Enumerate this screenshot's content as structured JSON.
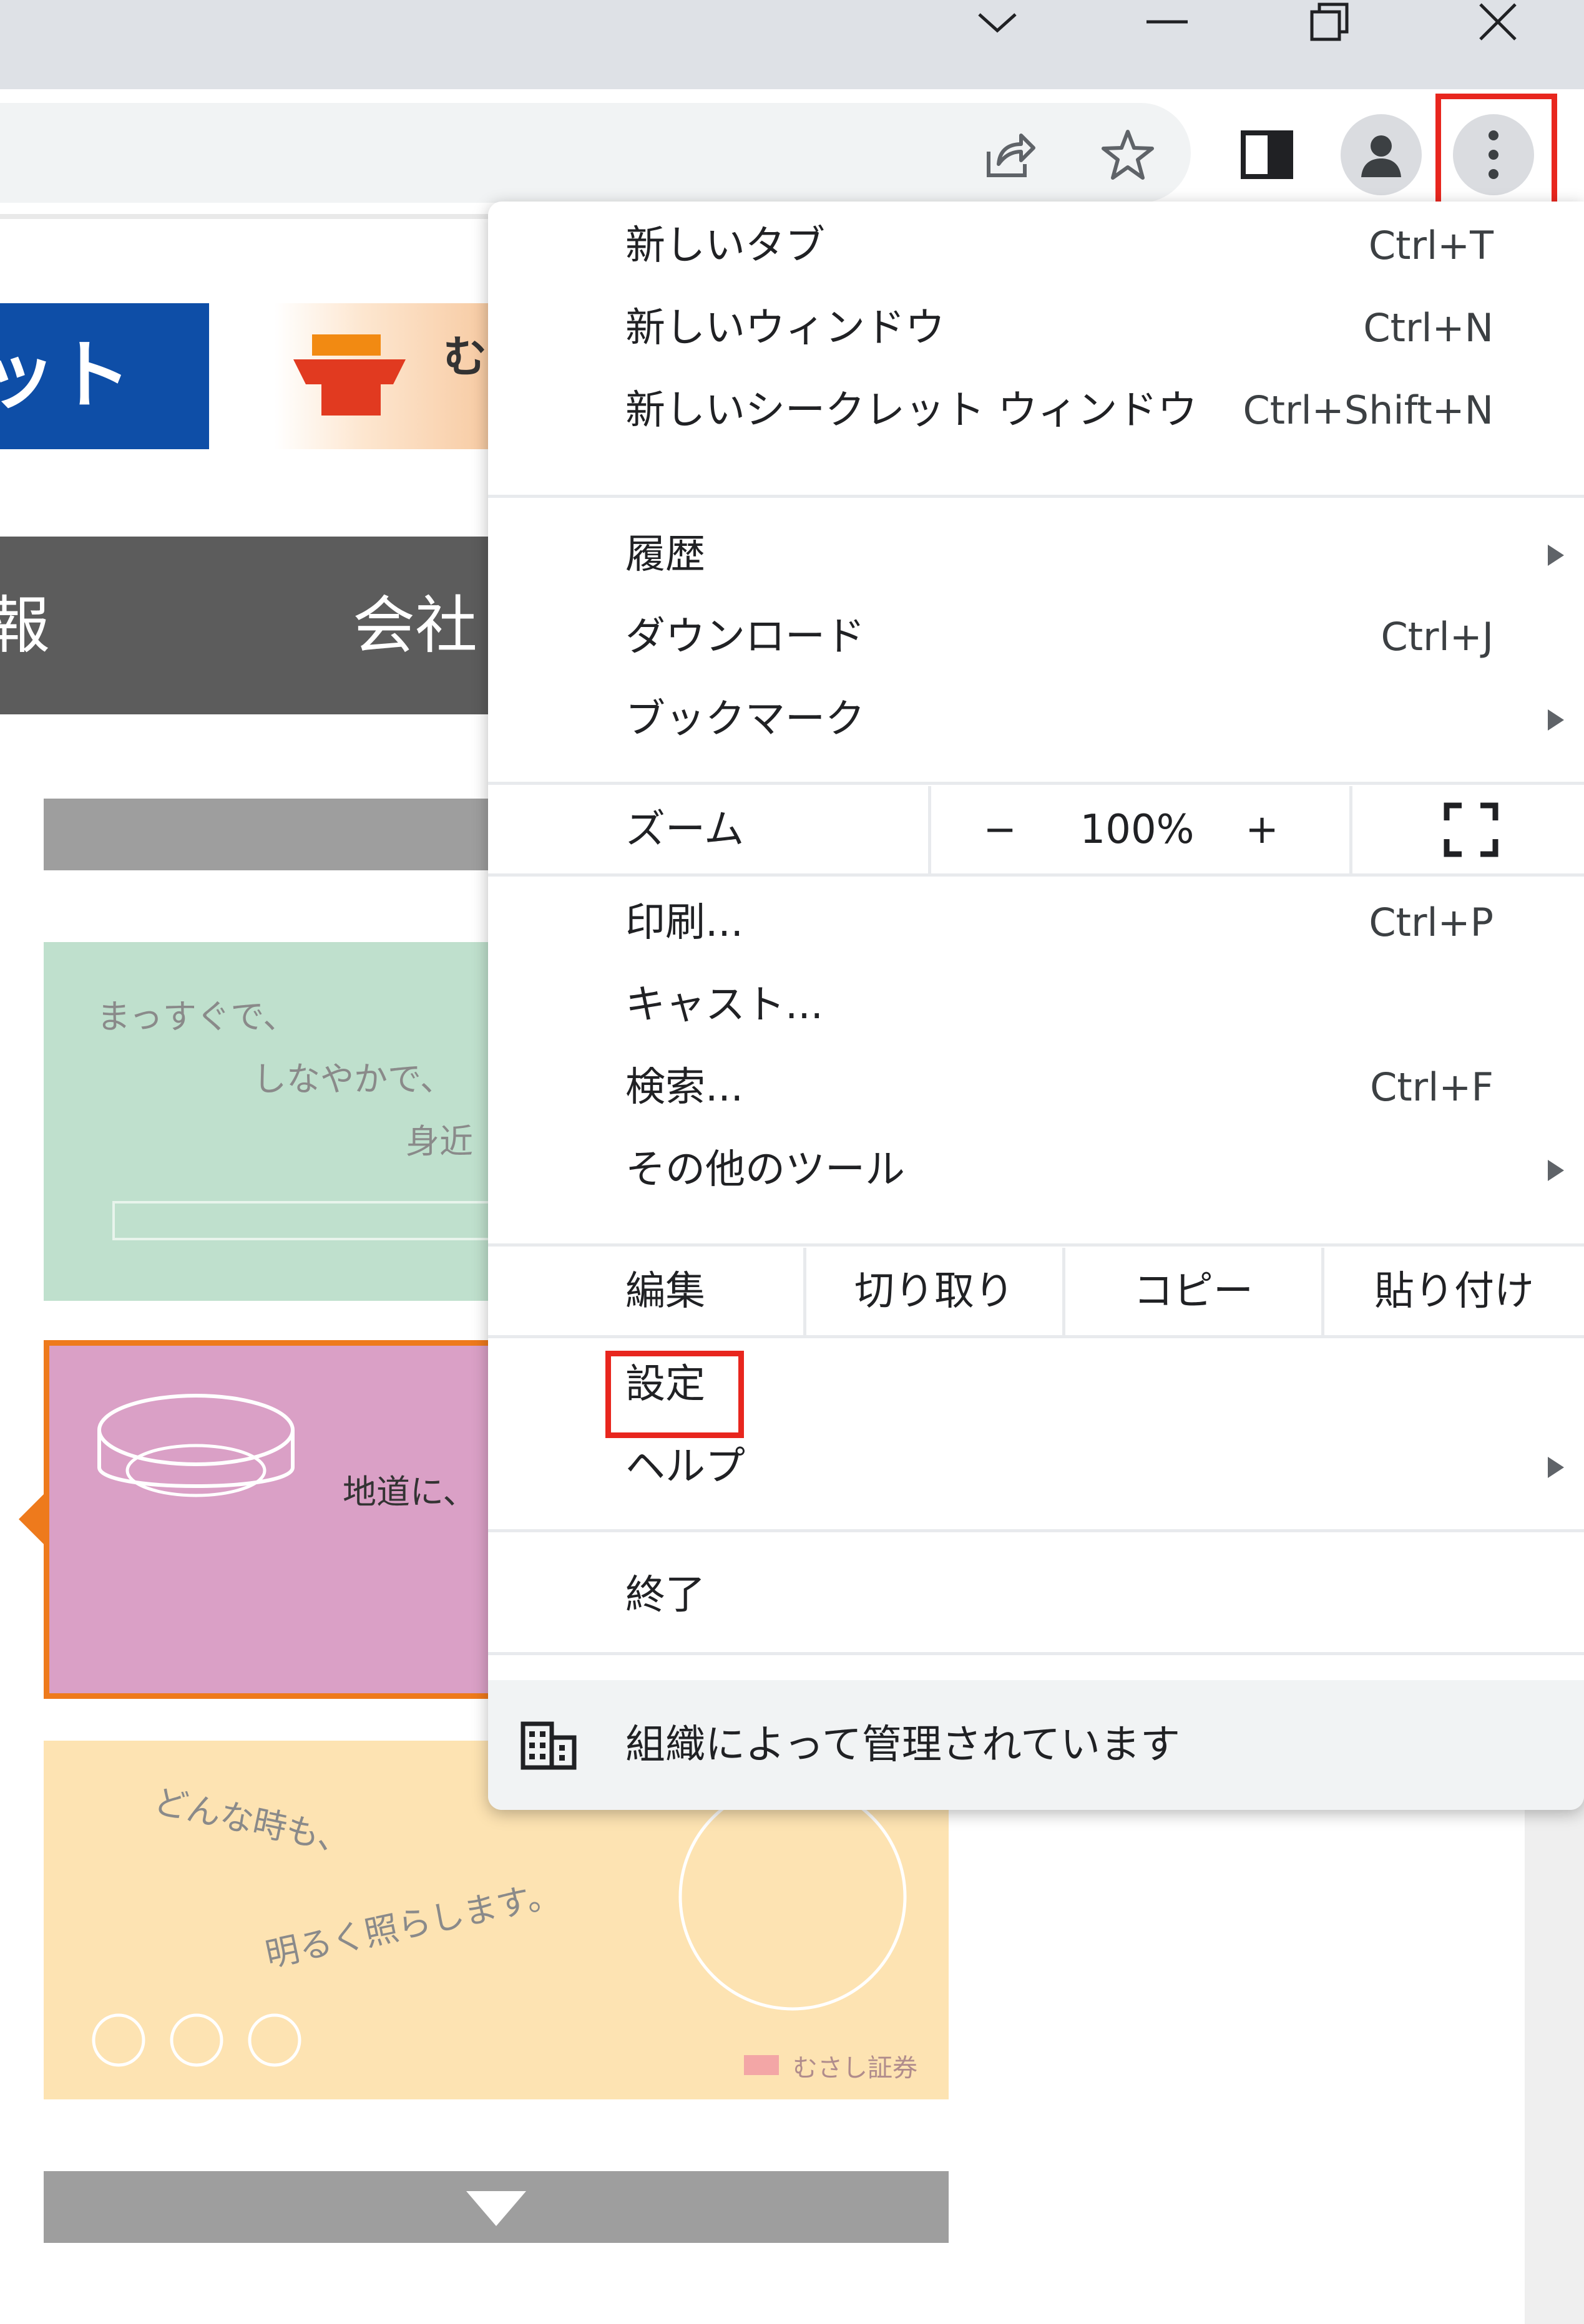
{
  "colors": {
    "highlight": "#e8261e",
    "titlebar": "#dee1e6",
    "omnibox": "#f1f3f4",
    "page_banner_blue": "#0e4ea7",
    "page_nav_gray": "#5c5c5c",
    "card_green": "#bfe0cd",
    "card_pink": "#daa0c6",
    "card_yellow": "#fde3b2",
    "card_pink_border": "#ee7a1c"
  },
  "window_controls": {
    "icons": [
      "chevron-down-icon",
      "minimize-icon",
      "restore-icon",
      "close-icon"
    ]
  },
  "toolbar": {
    "icons": [
      "share-icon",
      "bookmark-star-icon",
      "side-panel-icon",
      "profile-icon",
      "more-menu-icon"
    ]
  },
  "page": {
    "banner_text": "ット",
    "logo_text": "む",
    "nav_left": "報",
    "nav_company": "会社",
    "card1": [
      "まっすぐで、",
      "しなやかで、",
      "身近"
    ],
    "card2": [
      "地道に、"
    ],
    "card3": [
      "どんな時も、",
      "明るく照らします。"
    ],
    "card3_brand": "むさし証券"
  },
  "menu": {
    "new_tab": {
      "label": "新しいタブ",
      "shortcut": "Ctrl+T"
    },
    "new_window": {
      "label": "新しいウィンドウ",
      "shortcut": "Ctrl+N"
    },
    "incognito": {
      "label": "新しいシークレット ウィンドウ",
      "shortcut": "Ctrl+Shift+N"
    },
    "history": {
      "label": "履歴"
    },
    "downloads": {
      "label": "ダウンロード",
      "shortcut": "Ctrl+J"
    },
    "bookmarks": {
      "label": "ブックマーク"
    },
    "zoom": {
      "label": "ズーム",
      "minus": "−",
      "value": "100%",
      "plus": "+"
    },
    "print": {
      "label": "印刷...",
      "shortcut": "Ctrl+P"
    },
    "cast": {
      "label": "キャスト..."
    },
    "find": {
      "label": "検索...",
      "shortcut": "Ctrl+F"
    },
    "more_tools": {
      "label": "その他のツール"
    },
    "edit": {
      "label": "編集",
      "cut": "切り取り",
      "copy": "コピー",
      "paste": "貼り付け"
    },
    "settings": {
      "label": "設定"
    },
    "help": {
      "label": "ヘルプ"
    },
    "exit": {
      "label": "終了"
    },
    "managed": {
      "label": "組織によって管理されています"
    }
  }
}
